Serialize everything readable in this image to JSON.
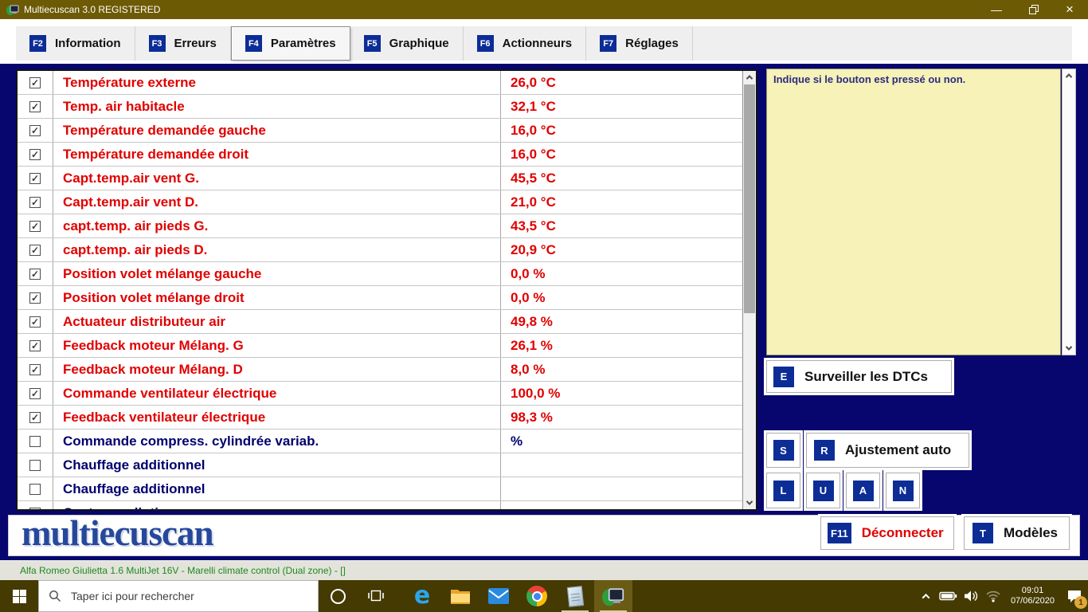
{
  "window": {
    "title": "Multiecuscan 3.0 REGISTERED",
    "controls": {
      "minimize_glyph": "—",
      "close_glyph": "×"
    }
  },
  "tabs": [
    {
      "key": "F2",
      "label": "Information",
      "active": false
    },
    {
      "key": "F3",
      "label": "Erreurs",
      "active": false
    },
    {
      "key": "F4",
      "label": "Paramètres",
      "active": true
    },
    {
      "key": "F5",
      "label": "Graphique",
      "active": false
    },
    {
      "key": "F6",
      "label": "Actionneurs",
      "active": false
    },
    {
      "key": "F7",
      "label": "Réglages",
      "active": false
    }
  ],
  "table": {
    "rows": [
      {
        "checked": true,
        "name": "Température externe",
        "value": "26,0 °C"
      },
      {
        "checked": true,
        "name": "Temp. air habitacle",
        "value": "32,1 °C"
      },
      {
        "checked": true,
        "name": "Température demandée gauche",
        "value": "16,0 °C"
      },
      {
        "checked": true,
        "name": "Température demandée droit",
        "value": "16,0 °C"
      },
      {
        "checked": true,
        "name": "Capt.temp.air vent G.",
        "value": "45,5 °C"
      },
      {
        "checked": true,
        "name": "Capt.temp.air vent D.",
        "value": "21,0 °C"
      },
      {
        "checked": true,
        "name": "capt.temp. air pieds G.",
        "value": "43,5 °C"
      },
      {
        "checked": true,
        "name": "capt.temp. air pieds D.",
        "value": "20,9 °C"
      },
      {
        "checked": true,
        "name": "Position volet mélange gauche",
        "value": "0,0 %"
      },
      {
        "checked": true,
        "name": "Position volet mélange droit",
        "value": "0,0 %"
      },
      {
        "checked": true,
        "name": "Actuateur distributeur air",
        "value": "49,8 %"
      },
      {
        "checked": true,
        "name": "Feedback moteur Mélang. G",
        "value": "26,1 %"
      },
      {
        "checked": true,
        "name": "Feedback moteur Mélang. D",
        "value": "8,0 %"
      },
      {
        "checked": true,
        "name": "Commande ventilateur électrique",
        "value": "100,0 %"
      },
      {
        "checked": true,
        "name": "Feedback ventilateur électrique",
        "value": "98,3 %"
      },
      {
        "checked": false,
        "name": "Commande compress. cylindrée variab.",
        "value": "%"
      },
      {
        "checked": false,
        "name": "Chauffage additionnel",
        "value": ""
      },
      {
        "checked": false,
        "name": "Chauffage additionnel",
        "value": ""
      },
      {
        "checked": false,
        "name": "Capteur pollution",
        "value": ""
      }
    ]
  },
  "info_panel": {
    "text": "Indique si le bouton est pressé ou non."
  },
  "side_panel": {
    "dtc_button": {
      "key": "E",
      "label": "Surveiller les DTCs"
    },
    "s_button": {
      "key": "S"
    },
    "adjust_button": {
      "key": "R",
      "label": "Ajustement auto"
    },
    "key_buttons": [
      "L",
      "U",
      "A",
      "N"
    ]
  },
  "footer": {
    "logo": "multiecuscan",
    "disconnect_button": {
      "key": "F11",
      "label": "Déconnecter"
    },
    "models_button": {
      "key": "T",
      "label": "Modèles"
    }
  },
  "status_bar": {
    "text": "Alfa Romeo Giulietta 1.6 MultiJet 16V - Marelli climate control (Dual zone) - []"
  },
  "taskbar": {
    "search_placeholder": "Taper ici pour rechercher",
    "clock": {
      "time": "09:01",
      "date": "07/06/2020"
    },
    "notification_count": "1"
  },
  "colors": {
    "accent_blue": "#0c2d96",
    "value_red": "#e10000",
    "param_navy": "#00006e",
    "app_navy": "#06066e",
    "panel_yellow": "#f6f2b8",
    "status_green": "#1d8a1d",
    "titlebar_olive": "#6d5a05",
    "taskbar_olive": "#443a02"
  }
}
